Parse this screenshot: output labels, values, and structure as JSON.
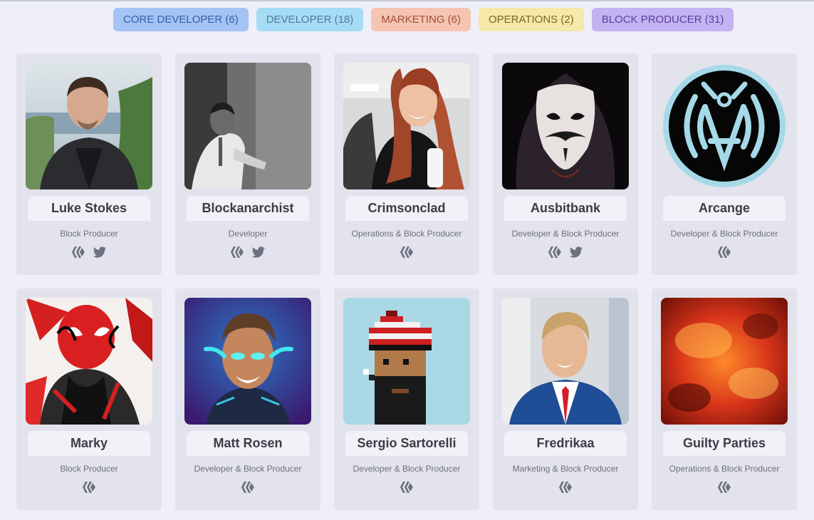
{
  "filters": [
    {
      "label": "CORE DEVELOPER (6)",
      "bg": "#a5c3f5",
      "fg": "#3360a8"
    },
    {
      "label": "DEVELOPER (18)",
      "bg": "#a6dbf5",
      "fg": "#4b7d97"
    },
    {
      "label": "MARKETING (6)",
      "bg": "#f5c5b2",
      "fg": "#a14d38"
    },
    {
      "label": "OPERATIONS (2)",
      "bg": "#f5e8a8",
      "fg": "#7b6420"
    },
    {
      "label": "BLOCK PRODUCER (31)",
      "bg": "#c3b3f2",
      "fg": "#5b3f9f"
    }
  ],
  "members": [
    {
      "name": "Luke Stokes",
      "role": "Block Producer",
      "socials": [
        "hive-icon",
        "twitter-icon"
      ]
    },
    {
      "name": "Blockanarchist",
      "role": "Developer",
      "socials": [
        "hive-icon",
        "twitter-icon"
      ]
    },
    {
      "name": "Crimsonclad",
      "role": "Operations & Block Producer",
      "socials": [
        "hive-icon"
      ]
    },
    {
      "name": "Ausbitbank",
      "role": "Developer & Block Producer",
      "socials": [
        "hive-icon",
        "twitter-icon"
      ]
    },
    {
      "name": "Arcange",
      "role": "Developer & Block Producer",
      "socials": [
        "hive-icon"
      ]
    },
    {
      "name": "Marky",
      "role": "Block Producer",
      "socials": [
        "hive-icon"
      ]
    },
    {
      "name": "Matt Rosen",
      "role": "Developer & Block Producer",
      "socials": [
        "hive-icon"
      ]
    },
    {
      "name": "Sergio Sartorelli",
      "role": "Developer & Block Producer",
      "socials": [
        "hive-icon"
      ]
    },
    {
      "name": "Fredrikaa",
      "role": "Marketing & Block Producer",
      "socials": [
        "hive-icon"
      ]
    },
    {
      "name": "Guilty Parties",
      "role": "Operations & Block Producer",
      "socials": [
        "hive-icon"
      ]
    }
  ]
}
